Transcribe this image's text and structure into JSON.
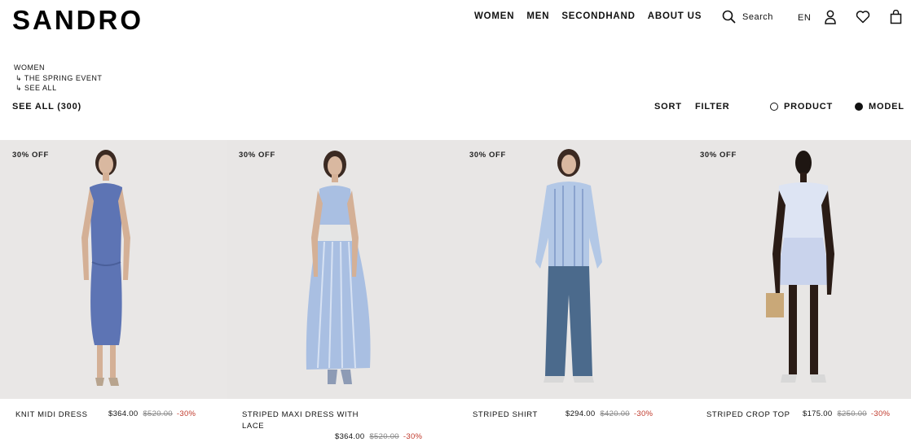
{
  "brand": {
    "logo": "SANDRO"
  },
  "nav": [
    "WOMEN",
    "MEN",
    "SECONDHAND",
    "ABOUT US"
  ],
  "header": {
    "search_label": "Search",
    "language": "EN"
  },
  "breadcrumb": {
    "level1": "WOMEN",
    "level2": "↳ THE SPRING EVENT",
    "level3": "↳ SEE ALL"
  },
  "toolbar": {
    "see_all": "SEE ALL (300)",
    "sort": "SORT",
    "filter": "FILTER",
    "view_product": "PRODUCT",
    "view_model": "MODEL",
    "selected_view": "MODEL"
  },
  "products": [
    {
      "badge": "30% OFF",
      "name": "KNIT MIDI DRESS",
      "price": "$364.00",
      "old_price": "$520.00",
      "discount": "-30%"
    },
    {
      "badge": "30% OFF",
      "name": "STRIPED MAXI DRESS WITH LACE",
      "price": "$364.00",
      "old_price": "$520.00",
      "discount": "-30%"
    },
    {
      "badge": "30% OFF",
      "name": "STRIPED SHIRT",
      "price": "$294.00",
      "old_price": "$420.00",
      "discount": "-30%"
    },
    {
      "badge": "30% OFF",
      "name": "STRIPED CROP TOP",
      "price": "$175.00",
      "old_price": "$250.00",
      "discount": "-30%"
    }
  ],
  "colors": {
    "discount": "#c0392b",
    "photo_bg": "#e8e6e5"
  }
}
